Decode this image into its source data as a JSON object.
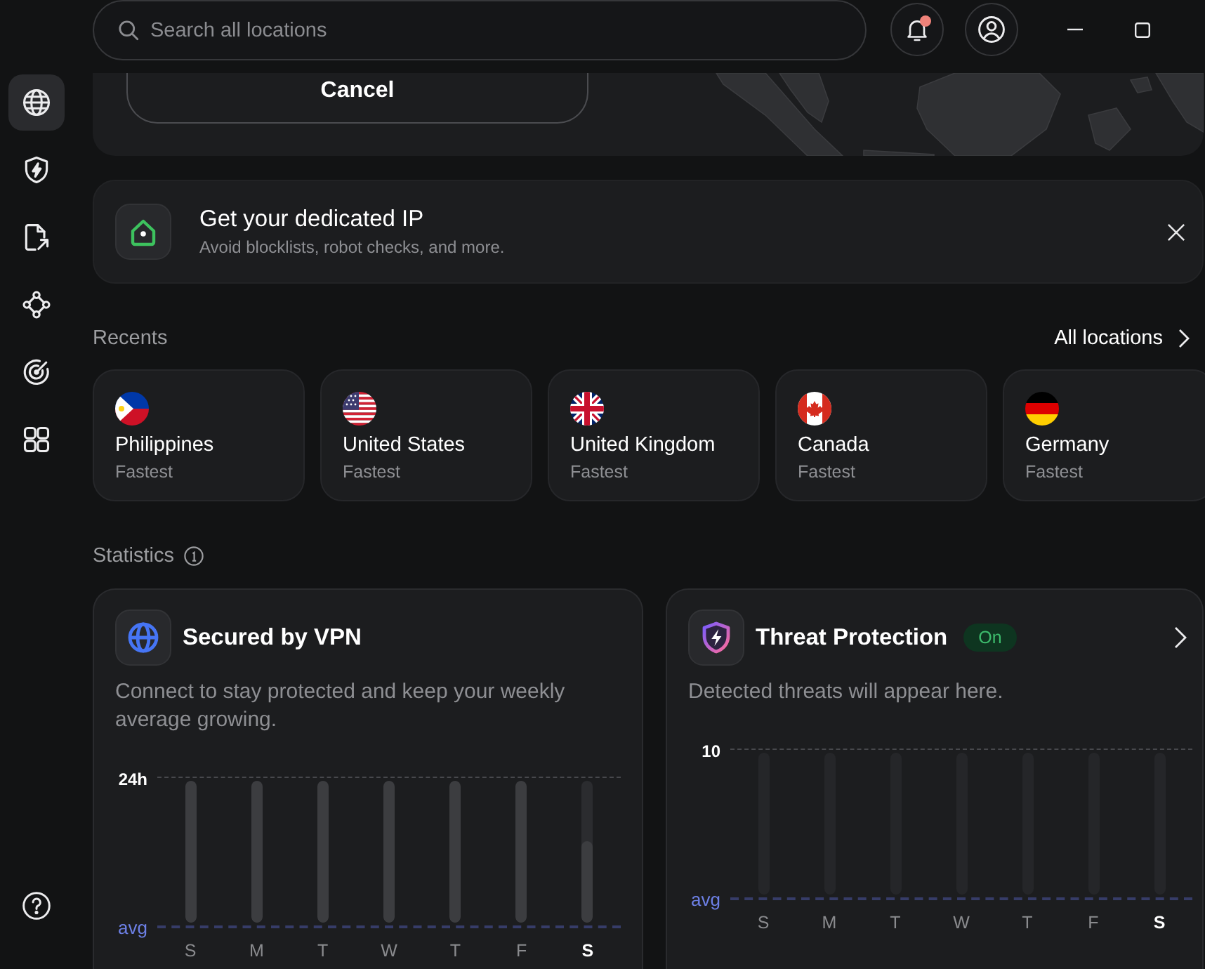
{
  "sidebar": {
    "items": [
      {
        "kind": "globe",
        "selected": true
      },
      {
        "kind": "shield",
        "selected": false
      },
      {
        "kind": "file",
        "selected": false
      },
      {
        "kind": "nodes",
        "selected": false
      },
      {
        "kind": "target",
        "selected": false
      },
      {
        "kind": "grid",
        "selected": false
      }
    ]
  },
  "top_bar": {
    "search": {
      "placeholder": "Search all locations"
    },
    "notifications": {
      "unread": true
    }
  },
  "map_panel": {
    "cancel_button": "Cancel"
  },
  "promo": {
    "title": "Get your dedicated IP",
    "subtitle": "Avoid blocklists, robot checks, and more."
  },
  "recents": {
    "title": "Recents",
    "link": "All locations",
    "items": [
      {
        "kind": "ph",
        "name": "Philippines",
        "detail": "Fastest"
      },
      {
        "kind": "us",
        "name": "United States",
        "detail": "Fastest"
      },
      {
        "kind": "gb",
        "name": "United Kingdom",
        "detail": "Fastest"
      },
      {
        "kind": "ca",
        "name": "Canada",
        "detail": "Fastest"
      },
      {
        "kind": "de",
        "name": "Germany",
        "detail": "Fastest"
      }
    ]
  },
  "statistics": {
    "title": "Statistics",
    "cards": [
      {
        "kind": "vpn",
        "title": "Secured by VPN",
        "description": "Connect to stay protected and keep your weekly average growing.",
        "chart": {
          "top_label": "24h",
          "avg_label": "avg",
          "days": [
            {
              "label": "S",
              "today": false,
              "level": 1
            },
            {
              "label": "M",
              "today": false,
              "level": 1
            },
            {
              "label": "T",
              "today": false,
              "level": 1
            },
            {
              "label": "W",
              "today": false,
              "level": 1
            },
            {
              "label": "T",
              "today": false,
              "level": 1
            },
            {
              "label": "F",
              "today": false,
              "level": 1
            },
            {
              "label": "S",
              "today": true,
              "level": 0.57
            }
          ]
        }
      },
      {
        "kind": "threat",
        "title": "Threat Protection",
        "status": "On",
        "description": "Detected threats will appear here.",
        "chart": {
          "top_label": "10",
          "avg_label": "avg",
          "days": [
            {
              "label": "S",
              "today": false
            },
            {
              "label": "M",
              "today": false
            },
            {
              "label": "T",
              "today": false
            },
            {
              "label": "W",
              "today": false
            },
            {
              "label": "T",
              "today": false
            },
            {
              "label": "F",
              "today": false
            },
            {
              "label": "S",
              "today": true
            }
          ]
        }
      }
    ]
  }
}
